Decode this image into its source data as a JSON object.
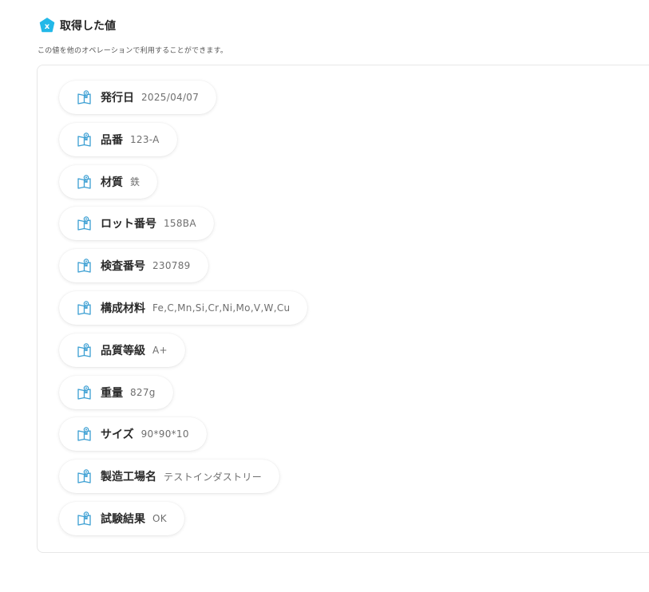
{
  "header": {
    "title": "取得した値",
    "description": "この値を他のオペレーションで利用することができます。",
    "badge_glyph": "x",
    "badge_color": "#22b8e8"
  },
  "colors": {
    "pill_label": "#2a2a2a",
    "pill_value": "#6f6f6f",
    "icon_stroke": "#3b9fd3",
    "panel_border": "#e7e7e7"
  },
  "items": [
    {
      "label": "発行日",
      "value": "2025/04/07"
    },
    {
      "label": "品番",
      "value": "123-A"
    },
    {
      "label": "材質",
      "value": "鉄"
    },
    {
      "label": "ロット番号",
      "value": "158BA"
    },
    {
      "label": "検査番号",
      "value": "230789"
    },
    {
      "label": "構成材料",
      "value": "Fe,C,Mn,Si,Cr,Ni,Mo,V,W,Cu"
    },
    {
      "label": "品質等級",
      "value": "A+"
    },
    {
      "label": "重量",
      "value": "827g"
    },
    {
      "label": "サイズ",
      "value": "90*90*10"
    },
    {
      "label": "製造工場名",
      "value": "テストインダストリー"
    },
    {
      "label": "試験結果",
      "value": "OK"
    }
  ]
}
